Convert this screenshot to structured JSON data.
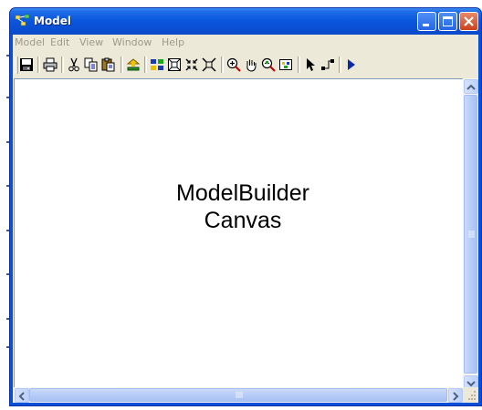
{
  "window": {
    "title": "Model",
    "controls": {
      "minimize": "minimize-button",
      "maximize": "maximize-button",
      "close": "close-button"
    }
  },
  "menubar": {
    "items": [
      {
        "label": "Model"
      },
      {
        "label": "Edit"
      },
      {
        "label": "View"
      },
      {
        "label": "Window"
      },
      {
        "label": "Help"
      }
    ]
  },
  "toolbar": {
    "buttons": [
      {
        "icon": "save-icon"
      },
      {
        "icon": "print-icon"
      },
      {
        "icon": "cut-icon"
      },
      {
        "icon": "copy-icon"
      },
      {
        "icon": "paste-icon"
      },
      {
        "icon": "add-data-icon"
      },
      {
        "icon": "auto-layout-icon"
      },
      {
        "icon": "full-extent-icon"
      },
      {
        "icon": "zoom-in-fixed-icon"
      },
      {
        "icon": "zoom-out-fixed-icon"
      },
      {
        "icon": "zoom-in-icon"
      },
      {
        "icon": "pan-icon"
      },
      {
        "icon": "zoom-out-icon"
      },
      {
        "icon": "overview-icon"
      },
      {
        "icon": "select-icon"
      },
      {
        "icon": "add-connection-icon"
      },
      {
        "icon": "run-icon"
      }
    ]
  },
  "canvas": {
    "line1": "ModelBuilder",
    "line2": "Canvas"
  },
  "colors": {
    "titlebar": "#0a4fd8",
    "client": "#ece9d8",
    "canvas": "#ffffff",
    "menu_text_disabled": "#9c9a8c"
  }
}
